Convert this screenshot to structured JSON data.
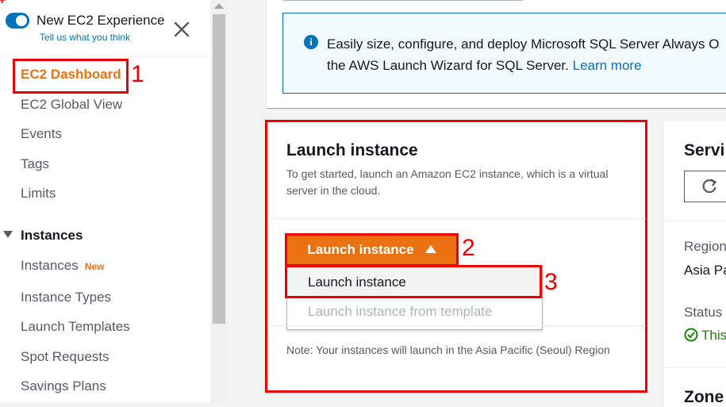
{
  "sidebar": {
    "toggle_label": "New EC2 Experience",
    "feedback_link": "Tell us what you think",
    "items": [
      {
        "label": "EC2 Dashboard"
      },
      {
        "label": "EC2 Global View"
      },
      {
        "label": "Events"
      },
      {
        "label": "Tags"
      },
      {
        "label": "Limits"
      }
    ],
    "section": "Instances",
    "section_items": [
      {
        "label": "Instances",
        "badge": "New"
      },
      {
        "label": "Instance Types"
      },
      {
        "label": "Launch Templates"
      },
      {
        "label": "Spot Requests"
      },
      {
        "label": "Savings Plans"
      }
    ]
  },
  "info": {
    "line1": "Easily size, configure, and deploy Microsoft SQL Server Always O",
    "line2": "the AWS Launch Wizard for SQL Server.",
    "link": "Learn more"
  },
  "launch": {
    "title": "Launch instance",
    "description": "To get started, launch an Amazon EC2 instance, which is a virtual server in the cloud.",
    "button": "Launch instance",
    "menu": [
      "Launch instance",
      "Launch instance from template"
    ],
    "note": "Note: Your instances will launch in the Asia Pacific (Seoul) Region"
  },
  "service": {
    "title": "Servi",
    "region_label": "Region",
    "region_value": "Asia Pa",
    "status_label": "Status",
    "status_value": "This",
    "zones_title": "Zone"
  },
  "annotations": [
    "1",
    "2",
    "3",
    "+"
  ],
  "colors": {
    "accent": "#ec7211",
    "link": "#0073bb",
    "highlight": "#e00000"
  }
}
